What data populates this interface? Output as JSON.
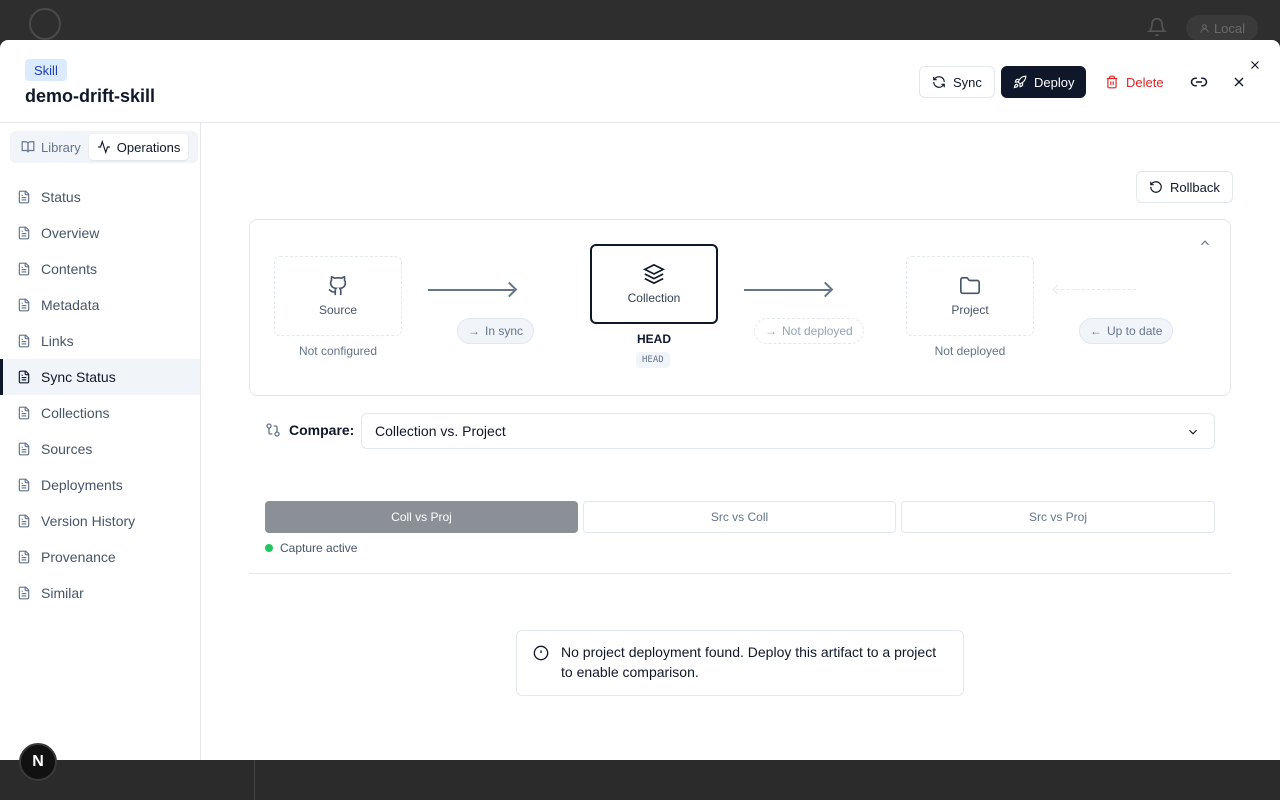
{
  "backdrop": {
    "user_label": "Local"
  },
  "header": {
    "badge": "Skill",
    "title": "demo-drift-skill",
    "sync_label": "Sync",
    "deploy_label": "Deploy",
    "delete_label": "Delete"
  },
  "sidebar": {
    "tabs": [
      {
        "label": "Library",
        "active": false
      },
      {
        "label": "Operations",
        "active": true
      }
    ],
    "items": [
      {
        "label": "Status"
      },
      {
        "label": "Overview"
      },
      {
        "label": "Contents"
      },
      {
        "label": "Metadata"
      },
      {
        "label": "Links"
      },
      {
        "label": "Sync Status",
        "active": true
      },
      {
        "label": "Collections"
      },
      {
        "label": "Sources"
      },
      {
        "label": "Deployments"
      },
      {
        "label": "Version History"
      },
      {
        "label": "Provenance"
      },
      {
        "label": "Similar"
      }
    ]
  },
  "main": {
    "rollback_label": "Rollback",
    "flow": {
      "source": {
        "label": "Source",
        "status": "Not configured"
      },
      "collection": {
        "label": "Collection",
        "version": "HEAD",
        "tag": "HEAD"
      },
      "project": {
        "label": "Project",
        "status": "Not deployed"
      },
      "pills": {
        "source_to_collection": "In sync",
        "collection_to_project": "Not deployed",
        "project_back": "Up to date"
      }
    },
    "compare": {
      "label": "Compare:",
      "selected": "Collection vs. Project"
    },
    "segments": [
      {
        "label": "Coll vs Proj",
        "active": true
      },
      {
        "label": "Src vs Coll",
        "active": false
      },
      {
        "label": "Src vs Proj",
        "active": false
      }
    ],
    "capture_status": "Capture active",
    "alert_text": "No project deployment found. Deploy this artifact to a project to enable comparison."
  },
  "devtools": {
    "label": "N"
  },
  "colors": {
    "accent": "#0f172a",
    "danger": "#dc2626",
    "success": "#22c55e",
    "badge_bg": "#dbeafe"
  }
}
